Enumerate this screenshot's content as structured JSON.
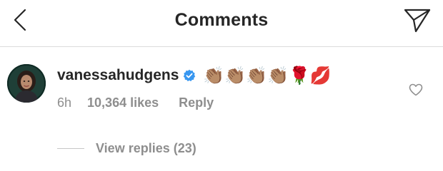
{
  "header": {
    "title": "Comments",
    "back_icon": "chevron-left-icon",
    "send_icon": "paper-plane-icon"
  },
  "comment": {
    "username": "vanessahudgens",
    "verified": true,
    "text": "👏🏽👏🏽👏🏽👏🏽🌹💋",
    "time": "6h",
    "likes": "10,364 likes",
    "reply_label": "Reply",
    "view_replies_label": "View replies (23)",
    "like_icon": "heart-outline-icon"
  },
  "colors": {
    "text_primary": "#262626",
    "text_secondary": "#8e8e8e",
    "divider": "#dbdbdb",
    "verified_blue": "#3897f0",
    "background": "#ffffff"
  }
}
